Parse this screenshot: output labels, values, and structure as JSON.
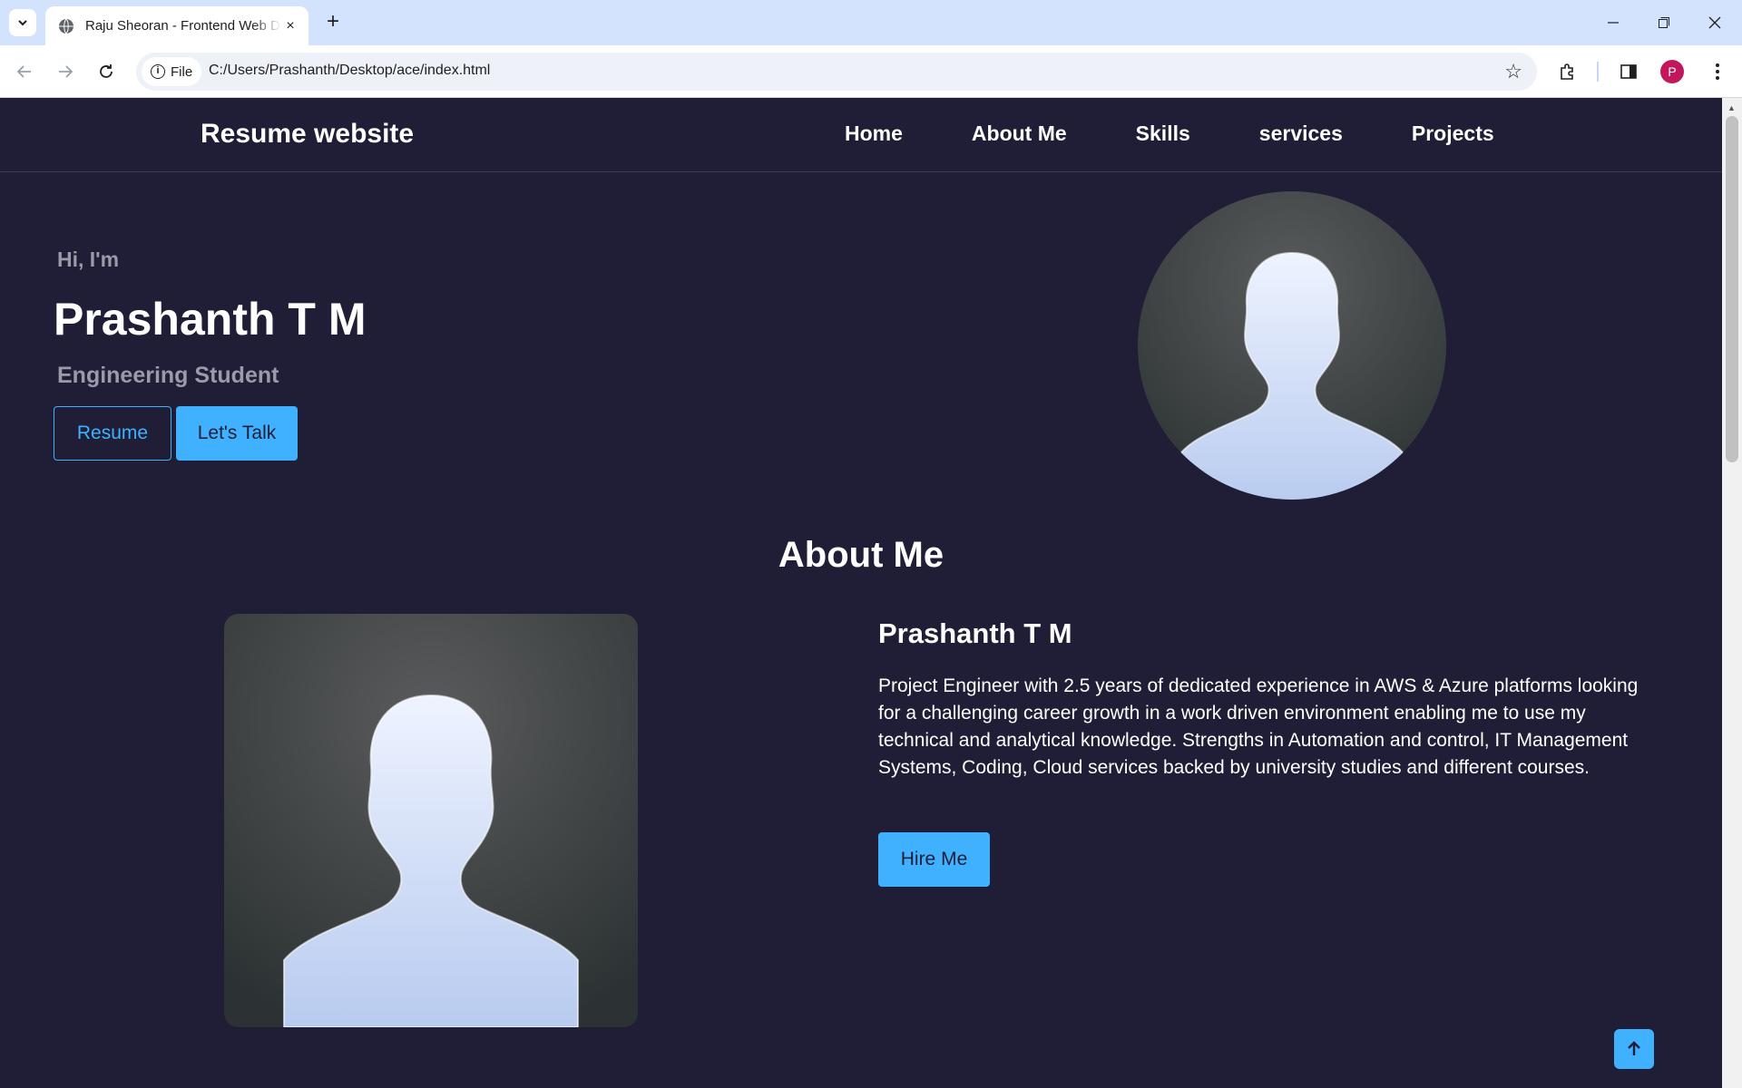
{
  "browser": {
    "tab_title": "Raju Sheoran - Frontend Web Developer",
    "close_tab": "×",
    "new_tab": "+",
    "chip_label": "File",
    "url": "C:/Users/Prashanth/Desktop/ace/index.html",
    "profile_initial": "P"
  },
  "site": {
    "brand": "Resume website",
    "nav": [
      "Home",
      "About Me",
      "Skills",
      "services",
      "Projects"
    ]
  },
  "hero": {
    "greeting": "Hi, I'm",
    "name": "Prashanth T M",
    "role": "Engineering Student",
    "resume_button": "Resume",
    "talk_button": "Let's Talk"
  },
  "about": {
    "title": "About Me",
    "name": "Prashanth T M",
    "description": "Project Engineer with 2.5 years of dedicated experience in AWS & Azure platforms looking for a challenging career growth in a work driven environment enabling me to use my technical and analytical knowledge. Strengths in Automation and control, IT Management Systems, Coding, Cloud services backed by university studies and different courses.",
    "hire_button": "Hire Me"
  },
  "colors": {
    "background": "#1f1e36",
    "accent": "#3fb1ff",
    "muted_text": "#9b9aab"
  },
  "icons": {
    "back_to_top": "arrow-up-icon"
  }
}
